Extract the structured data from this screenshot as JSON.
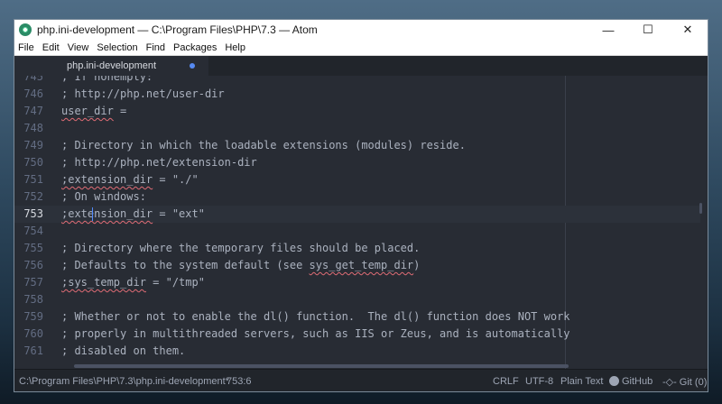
{
  "window": {
    "title": "php.ini-development — C:\\Program Files\\PHP\\7.3 — Atom",
    "minimize": "—",
    "maximize": "☐",
    "close": "✕"
  },
  "menu": [
    "File",
    "Edit",
    "View",
    "Selection",
    "Find",
    "Packages",
    "Help"
  ],
  "tab": {
    "label": "php.ini-development",
    "modified": true
  },
  "editor": {
    "lines": [
      {
        "n": "746",
        "text": "; http://php.net/user-dir"
      },
      {
        "n": "747",
        "text": "user_dir ="
      },
      {
        "n": "748",
        "text": ""
      },
      {
        "n": "749",
        "text": "; Directory in which the loadable extensions (modules) reside."
      },
      {
        "n": "750",
        "text": "; http://php.net/extension-dir"
      },
      {
        "n": "751",
        "text": ";extension_dir = \"./\""
      },
      {
        "n": "752",
        "text": "; On windows:"
      },
      {
        "n": "753",
        "text": ";extension_dir = \"ext\""
      },
      {
        "n": "754",
        "text": ""
      },
      {
        "n": "755",
        "text": "; Directory where the temporary files should be placed."
      },
      {
        "n": "756",
        "text": "; Defaults to the system default (see sys_get_temp_dir)"
      },
      {
        "n": "757",
        "text": ";sys_temp_dir = \"/tmp\""
      },
      {
        "n": "758",
        "text": ""
      },
      {
        "n": "759",
        "text": "; Whether or not to enable the dl() function.  The dl() function does NOT work"
      },
      {
        "n": "760",
        "text": "; properly in multithreaded servers, such as IIS or Zeus, and is automatically"
      },
      {
        "n": "761",
        "text": "; disabled on them."
      }
    ]
  },
  "status": {
    "path": "C:\\Program Files\\PHP\\7.3\\php.ini-development*",
    "cursor": "753:6",
    "line_ending": "CRLF",
    "encoding": "UTF-8",
    "grammar": "Plain Text",
    "github": "GitHub",
    "git": "Git (0)"
  }
}
